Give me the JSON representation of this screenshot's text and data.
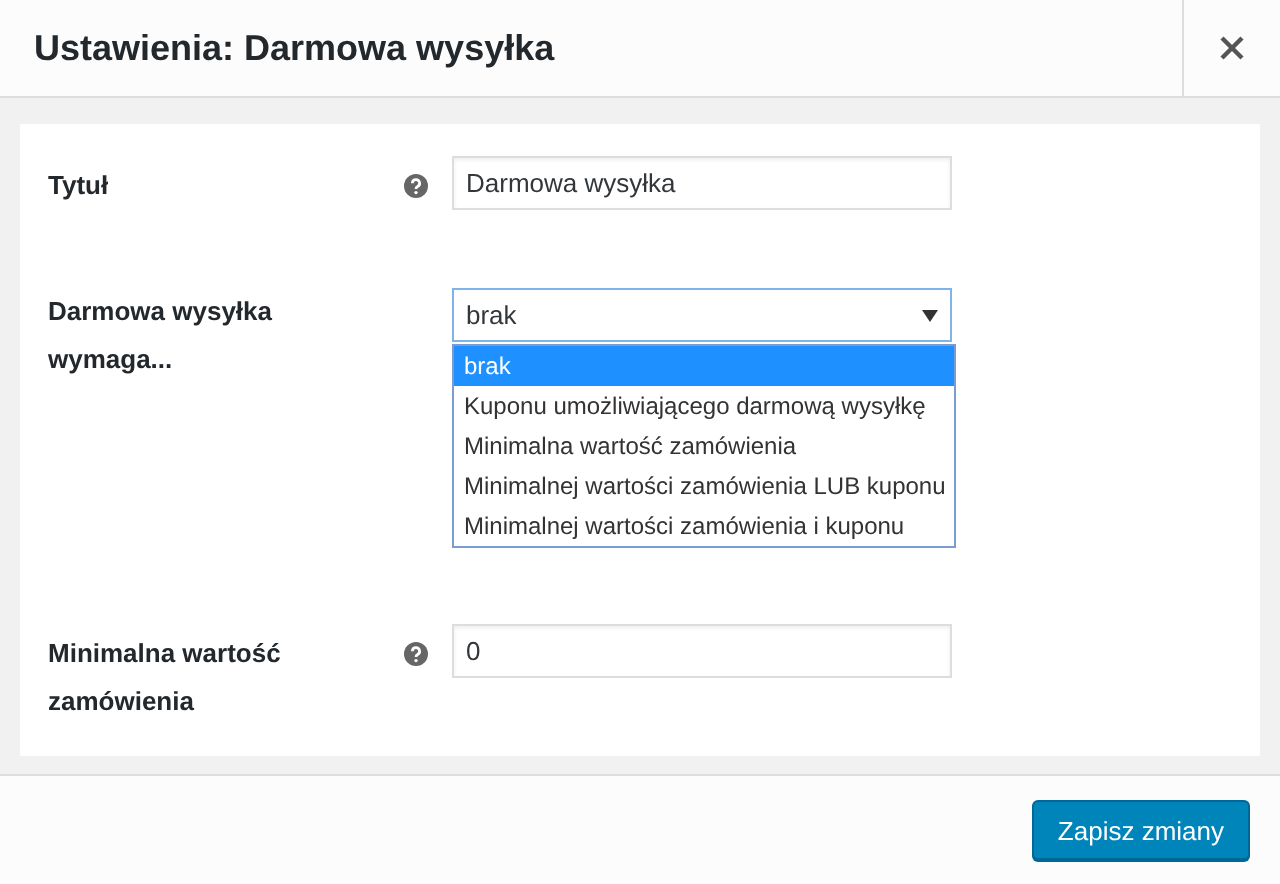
{
  "dialog": {
    "title": "Ustawienia: Darmowa wysyłka"
  },
  "fields": [
    {
      "kind": "text",
      "label": "Tytuł",
      "help": true,
      "value": "Darmowa wysyłka"
    },
    {
      "kind": "select",
      "label": "Darmowa wysyłka wymaga...",
      "help": false,
      "value": "brak",
      "expanded": true,
      "options": [
        {
          "label": "brak",
          "selected": true
        },
        {
          "label": "Kuponu umożliwiającego darmową wysyłkę",
          "selected": false
        },
        {
          "label": "Minimalna wartość zamówienia",
          "selected": false
        },
        {
          "label": "Minimalnej wartości zamówienia LUB kuponu",
          "selected": false
        },
        {
          "label": "Minimalnej wartości zamówienia i kuponu",
          "selected": false
        }
      ]
    },
    {
      "kind": "text",
      "label": "Minimalna wartość zamówienia",
      "help": true,
      "value": "0"
    }
  ],
  "footer": {
    "save_button": "Zapisz zmiany"
  }
}
